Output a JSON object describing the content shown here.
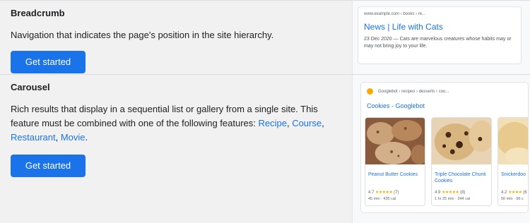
{
  "breadcrumb": {
    "title": "Breadcrumb",
    "description": "Navigation that indicates the page's position in the site hierarchy.",
    "button_label": "Get started",
    "preview": {
      "url": "www.example.com › books › re...",
      "title": "News | Life with Cats",
      "snippet_date": "23 Dec 2020",
      "snippet_text": "— Cats are marvelous creatures whose habits may or may not bring joy to your life."
    }
  },
  "carousel": {
    "title": "Carousel",
    "description_pre": "Rich results that display in a sequential list or gallery from a single site. This feature must be combined with one of the following features: ",
    "links": [
      "Recipe",
      "Course",
      "Restaurant",
      "Movie"
    ],
    "separator": ", ",
    "terminal": ".",
    "button_label": "Get started",
    "preview": {
      "url": "Googlebot › recipes › desserts › coo...",
      "title": "Cookies - Googlebot",
      "tiles": [
        {
          "name": "Peanut Butter Cookies",
          "rating": "4.7",
          "stars": "★★★★★",
          "count": "(7)",
          "meta": "45 min · 435 cal"
        },
        {
          "name": "Triple Chocolate Chunk Cookies",
          "rating": "4.9",
          "stars": "★★★★★",
          "count": "(8)",
          "meta": "1 hr 25 min · 344 cal"
        },
        {
          "name": "Snickerdoo",
          "rating": "4.2",
          "stars": "★★★★",
          "count": "(6",
          "meta": "50 min · 96 c"
        }
      ]
    }
  },
  "colors": {
    "accent": "#1a73e8",
    "star": "#f9ab00",
    "background": "#f1f1f1"
  }
}
